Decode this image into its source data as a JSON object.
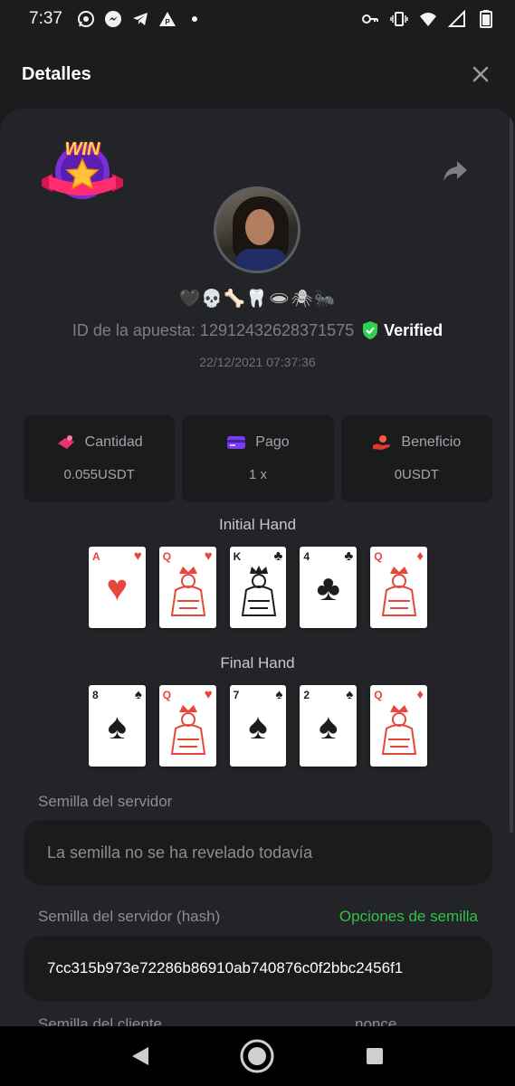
{
  "status_bar": {
    "time": "7:37",
    "left_icons": [
      "whatsapp-icon",
      "messenger-icon",
      "telegram-icon",
      "app-icon",
      "dot-icon"
    ],
    "right_icons": [
      "vpn-key-icon",
      "vibrate-icon",
      "wifi-icon",
      "signal-icon",
      "battery-icon"
    ]
  },
  "header": {
    "title": "Detalles"
  },
  "bet": {
    "emoji_name": "🖤💀🦴🦷🕳🕷🐜",
    "id_label": "ID de la apuesta: 12912432628371575",
    "verified_label": "Verified",
    "date": "22/12/2021 07:37:36",
    "badge_text": "WIN"
  },
  "stats": [
    {
      "label": "Cantidad",
      "value": "0.055USDT",
      "icon": "amount-icon"
    },
    {
      "label": "Pago",
      "value": "1 x",
      "icon": "payout-card-icon"
    },
    {
      "label": "Beneficio",
      "value": "0USDT",
      "icon": "profit-hand-icon"
    }
  ],
  "initial_hand": {
    "title": "Initial Hand",
    "cards": [
      {
        "rank": "A",
        "suit": "♥",
        "color": "red"
      },
      {
        "rank": "Q",
        "suit": "♥",
        "color": "red"
      },
      {
        "rank": "K",
        "suit": "♣",
        "color": "black"
      },
      {
        "rank": "4",
        "suit": "♣",
        "color": "black"
      },
      {
        "rank": "Q",
        "suit": "♦",
        "color": "red"
      }
    ]
  },
  "final_hand": {
    "title": "Final Hand",
    "cards": [
      {
        "rank": "8",
        "suit": "♠",
        "color": "black"
      },
      {
        "rank": "Q",
        "suit": "♥",
        "color": "red"
      },
      {
        "rank": "7",
        "suit": "♠",
        "color": "black"
      },
      {
        "rank": "2",
        "suit": "♠",
        "color": "black"
      },
      {
        "rank": "Q",
        "suit": "♦",
        "color": "red"
      }
    ]
  },
  "server_seed": {
    "label": "Semilla del servidor",
    "value": "La semilla no se ha revelado todavía"
  },
  "server_seed_hash": {
    "label": "Semilla del servidor (hash)",
    "options_link": "Opciones de semilla",
    "value": "7cc315b973e72286b86910ab740876c0f2bbc2456f1"
  },
  "client_seed": {
    "label": "Semilla del cliente",
    "nonce_label": "nonce"
  },
  "colors": {
    "accent_green": "#35c04a",
    "card_red": "#e5473a",
    "panel_bg": "#232427",
    "box_bg": "#1a1b1d"
  }
}
